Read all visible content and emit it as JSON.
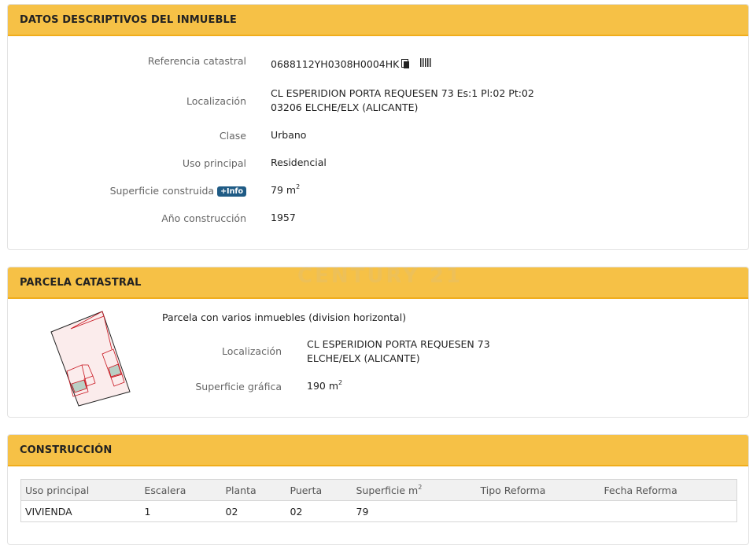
{
  "descriptivos": {
    "title": "DATOS DESCRIPTIVOS DEL INMUEBLE",
    "fields": [
      {
        "label": "Referencia catastral",
        "value": "0688112YH0308H0004HK"
      },
      {
        "label": "Localización",
        "value_line1": "CL ESPERIDION PORTA REQUESEN 73 Es:1 Pl:02 Pt:02",
        "value_line2": "03206 ELCHE/ELX (ALICANTE)"
      },
      {
        "label": "Clase",
        "value": "Urbano"
      },
      {
        "label": "Uso principal",
        "value": "Residencial"
      },
      {
        "label": "Superficie construida",
        "badge": "+Info",
        "value": "79 m",
        "unit_sup": "2"
      },
      {
        "label": "Año construcción",
        "value": "1957"
      }
    ],
    "icons": [
      "copy-icon",
      "barcode-icon"
    ]
  },
  "watermark": "CENTURY 21",
  "parcela": {
    "title": "PARCELA CATASTRAL",
    "description": "Parcela con varios inmuebles (division horizontal)",
    "localizacion_label": "Localización",
    "localizacion_line1": "CL ESPERIDION PORTA REQUESEN 73",
    "localizacion_line2": "ELCHE/ELX (ALICANTE)",
    "superficie_label": "Superficie gráfica",
    "superficie_value": "190 m",
    "superficie_sup": "2"
  },
  "construccion": {
    "title": "CONSTRUCCIÓN",
    "headers": [
      "Uso principal",
      "Escalera",
      "Planta",
      "Puerta",
      "Superficie m",
      "Tipo Reforma",
      "Fecha Reforma"
    ],
    "header_sup": "2",
    "rows": [
      [
        "VIVIENDA",
        "1",
        "02",
        "02",
        "79",
        "",
        ""
      ]
    ]
  },
  "colors": {
    "header_bg": "#f6c146",
    "badge_bg": "#1f5b85",
    "parcel_stroke": "#c8141e"
  }
}
